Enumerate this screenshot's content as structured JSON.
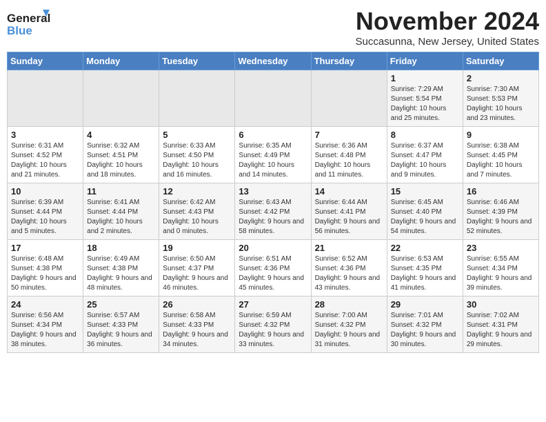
{
  "header": {
    "logo_general": "General",
    "logo_blue": "Blue",
    "month_title": "November 2024",
    "location": "Succasunna, New Jersey, United States"
  },
  "days_of_week": [
    "Sunday",
    "Monday",
    "Tuesday",
    "Wednesday",
    "Thursday",
    "Friday",
    "Saturday"
  ],
  "weeks": [
    [
      {
        "day": "",
        "sunrise": "",
        "sunset": "",
        "daylight": "",
        "empty": true
      },
      {
        "day": "",
        "sunrise": "",
        "sunset": "",
        "daylight": "",
        "empty": true
      },
      {
        "day": "",
        "sunrise": "",
        "sunset": "",
        "daylight": "",
        "empty": true
      },
      {
        "day": "",
        "sunrise": "",
        "sunset": "",
        "daylight": "",
        "empty": true
      },
      {
        "day": "",
        "sunrise": "",
        "sunset": "",
        "daylight": "",
        "empty": true
      },
      {
        "day": "1",
        "sunrise": "Sunrise: 7:29 AM",
        "sunset": "Sunset: 5:54 PM",
        "daylight": "Daylight: 10 hours and 25 minutes."
      },
      {
        "day": "2",
        "sunrise": "Sunrise: 7:30 AM",
        "sunset": "Sunset: 5:53 PM",
        "daylight": "Daylight: 10 hours and 23 minutes."
      }
    ],
    [
      {
        "day": "3",
        "sunrise": "Sunrise: 6:31 AM",
        "sunset": "Sunset: 4:52 PM",
        "daylight": "Daylight: 10 hours and 21 minutes."
      },
      {
        "day": "4",
        "sunrise": "Sunrise: 6:32 AM",
        "sunset": "Sunset: 4:51 PM",
        "daylight": "Daylight: 10 hours and 18 minutes."
      },
      {
        "day": "5",
        "sunrise": "Sunrise: 6:33 AM",
        "sunset": "Sunset: 4:50 PM",
        "daylight": "Daylight: 10 hours and 16 minutes."
      },
      {
        "day": "6",
        "sunrise": "Sunrise: 6:35 AM",
        "sunset": "Sunset: 4:49 PM",
        "daylight": "Daylight: 10 hours and 14 minutes."
      },
      {
        "day": "7",
        "sunrise": "Sunrise: 6:36 AM",
        "sunset": "Sunset: 4:48 PM",
        "daylight": "Daylight: 10 hours and 11 minutes."
      },
      {
        "day": "8",
        "sunrise": "Sunrise: 6:37 AM",
        "sunset": "Sunset: 4:47 PM",
        "daylight": "Daylight: 10 hours and 9 minutes."
      },
      {
        "day": "9",
        "sunrise": "Sunrise: 6:38 AM",
        "sunset": "Sunset: 4:45 PM",
        "daylight": "Daylight: 10 hours and 7 minutes."
      }
    ],
    [
      {
        "day": "10",
        "sunrise": "Sunrise: 6:39 AM",
        "sunset": "Sunset: 4:44 PM",
        "daylight": "Daylight: 10 hours and 5 minutes."
      },
      {
        "day": "11",
        "sunrise": "Sunrise: 6:41 AM",
        "sunset": "Sunset: 4:44 PM",
        "daylight": "Daylight: 10 hours and 2 minutes."
      },
      {
        "day": "12",
        "sunrise": "Sunrise: 6:42 AM",
        "sunset": "Sunset: 4:43 PM",
        "daylight": "Daylight: 10 hours and 0 minutes."
      },
      {
        "day": "13",
        "sunrise": "Sunrise: 6:43 AM",
        "sunset": "Sunset: 4:42 PM",
        "daylight": "Daylight: 9 hours and 58 minutes."
      },
      {
        "day": "14",
        "sunrise": "Sunrise: 6:44 AM",
        "sunset": "Sunset: 4:41 PM",
        "daylight": "Daylight: 9 hours and 56 minutes."
      },
      {
        "day": "15",
        "sunrise": "Sunrise: 6:45 AM",
        "sunset": "Sunset: 4:40 PM",
        "daylight": "Daylight: 9 hours and 54 minutes."
      },
      {
        "day": "16",
        "sunrise": "Sunrise: 6:46 AM",
        "sunset": "Sunset: 4:39 PM",
        "daylight": "Daylight: 9 hours and 52 minutes."
      }
    ],
    [
      {
        "day": "17",
        "sunrise": "Sunrise: 6:48 AM",
        "sunset": "Sunset: 4:38 PM",
        "daylight": "Daylight: 9 hours and 50 minutes."
      },
      {
        "day": "18",
        "sunrise": "Sunrise: 6:49 AM",
        "sunset": "Sunset: 4:38 PM",
        "daylight": "Daylight: 9 hours and 48 minutes."
      },
      {
        "day": "19",
        "sunrise": "Sunrise: 6:50 AM",
        "sunset": "Sunset: 4:37 PM",
        "daylight": "Daylight: 9 hours and 46 minutes."
      },
      {
        "day": "20",
        "sunrise": "Sunrise: 6:51 AM",
        "sunset": "Sunset: 4:36 PM",
        "daylight": "Daylight: 9 hours and 45 minutes."
      },
      {
        "day": "21",
        "sunrise": "Sunrise: 6:52 AM",
        "sunset": "Sunset: 4:36 PM",
        "daylight": "Daylight: 9 hours and 43 minutes."
      },
      {
        "day": "22",
        "sunrise": "Sunrise: 6:53 AM",
        "sunset": "Sunset: 4:35 PM",
        "daylight": "Daylight: 9 hours and 41 minutes."
      },
      {
        "day": "23",
        "sunrise": "Sunrise: 6:55 AM",
        "sunset": "Sunset: 4:34 PM",
        "daylight": "Daylight: 9 hours and 39 minutes."
      }
    ],
    [
      {
        "day": "24",
        "sunrise": "Sunrise: 6:56 AM",
        "sunset": "Sunset: 4:34 PM",
        "daylight": "Daylight: 9 hours and 38 minutes."
      },
      {
        "day": "25",
        "sunrise": "Sunrise: 6:57 AM",
        "sunset": "Sunset: 4:33 PM",
        "daylight": "Daylight: 9 hours and 36 minutes."
      },
      {
        "day": "26",
        "sunrise": "Sunrise: 6:58 AM",
        "sunset": "Sunset: 4:33 PM",
        "daylight": "Daylight: 9 hours and 34 minutes."
      },
      {
        "day": "27",
        "sunrise": "Sunrise: 6:59 AM",
        "sunset": "Sunset: 4:32 PM",
        "daylight": "Daylight: 9 hours and 33 minutes."
      },
      {
        "day": "28",
        "sunrise": "Sunrise: 7:00 AM",
        "sunset": "Sunset: 4:32 PM",
        "daylight": "Daylight: 9 hours and 31 minutes."
      },
      {
        "day": "29",
        "sunrise": "Sunrise: 7:01 AM",
        "sunset": "Sunset: 4:32 PM",
        "daylight": "Daylight: 9 hours and 30 minutes."
      },
      {
        "day": "30",
        "sunrise": "Sunrise: 7:02 AM",
        "sunset": "Sunset: 4:31 PM",
        "daylight": "Daylight: 9 hours and 29 minutes."
      }
    ]
  ]
}
